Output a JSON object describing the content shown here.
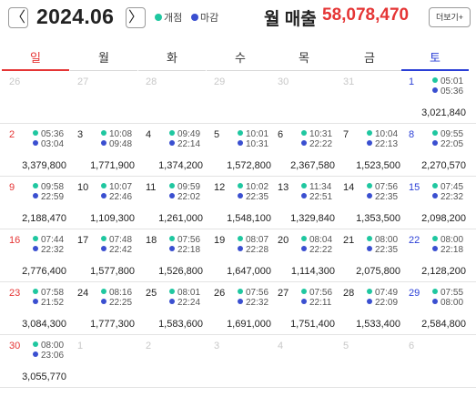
{
  "header": {
    "prev_label": "〈",
    "next_label": "〉",
    "month": "2024.06",
    "legend_open": "개점",
    "legend_close": "마감",
    "sales_label": "월 매출",
    "sales_value": "58,078,470",
    "more_label": "더보기+"
  },
  "colors": {
    "open_dot": "#1fc7a0",
    "close_dot": "#3a4fd0",
    "sunday": "#e53535",
    "saturday": "#2a3fd6",
    "sales": "#e53535"
  },
  "weekdays": [
    "일",
    "월",
    "화",
    "수",
    "목",
    "금",
    "토"
  ],
  "weeks": [
    [
      {
        "day": "26",
        "out": true
      },
      {
        "day": "27",
        "out": true
      },
      {
        "day": "28",
        "out": true
      },
      {
        "day": "29",
        "out": true
      },
      {
        "day": "30",
        "out": true
      },
      {
        "day": "31",
        "out": true
      },
      {
        "day": "1",
        "open": "05:01",
        "close": "05:36",
        "total": "3,021,840"
      }
    ],
    [
      {
        "day": "2",
        "open": "05:36",
        "close": "03:04",
        "total": "3,379,800"
      },
      {
        "day": "3",
        "open": "10:08",
        "close": "09:48",
        "total": "1,771,900"
      },
      {
        "day": "4",
        "open": "09:49",
        "close": "22:14",
        "total": "1,374,200"
      },
      {
        "day": "5",
        "open": "10:01",
        "close": "10:31",
        "total": "1,572,800"
      },
      {
        "day": "6",
        "open": "10:31",
        "close": "22:22",
        "total": "2,367,580"
      },
      {
        "day": "7",
        "open": "10:04",
        "close": "22:13",
        "total": "1,523,500"
      },
      {
        "day": "8",
        "open": "09:55",
        "close": "22:05",
        "total": "2,270,570"
      }
    ],
    [
      {
        "day": "9",
        "open": "09:58",
        "close": "22:59",
        "total": "2,188,470"
      },
      {
        "day": "10",
        "open": "10:07",
        "close": "22:46",
        "total": "1,109,300"
      },
      {
        "day": "11",
        "open": "09:59",
        "close": "22:02",
        "total": "1,261,000"
      },
      {
        "day": "12",
        "open": "10:02",
        "close": "22:35",
        "total": "1,548,100"
      },
      {
        "day": "13",
        "open": "11:34",
        "close": "22:51",
        "total": "1,329,840"
      },
      {
        "day": "14",
        "open": "07:56",
        "close": "22:35",
        "total": "1,353,500"
      },
      {
        "day": "15",
        "open": "07:45",
        "close": "22:32",
        "total": "2,098,200"
      }
    ],
    [
      {
        "day": "16",
        "open": "07:44",
        "close": "22:32",
        "total": "2,776,400"
      },
      {
        "day": "17",
        "open": "07:48",
        "close": "22:42",
        "total": "1,577,800"
      },
      {
        "day": "18",
        "open": "07:56",
        "close": "22:18",
        "total": "1,526,800"
      },
      {
        "day": "19",
        "open": "08:07",
        "close": "22:28",
        "total": "1,647,000"
      },
      {
        "day": "20",
        "open": "08:04",
        "close": "22:22",
        "total": "1,114,300"
      },
      {
        "day": "21",
        "open": "08:00",
        "close": "22:35",
        "total": "2,075,800"
      },
      {
        "day": "22",
        "open": "08:00",
        "close": "22:18",
        "total": "2,128,200"
      }
    ],
    [
      {
        "day": "23",
        "open": "07:58",
        "close": "21:52",
        "total": "3,084,300"
      },
      {
        "day": "24",
        "open": "08:16",
        "close": "22:25",
        "total": "1,777,300"
      },
      {
        "day": "25",
        "open": "08:01",
        "close": "22:24",
        "total": "1,583,600"
      },
      {
        "day": "26",
        "open": "07:56",
        "close": "22:32",
        "total": "1,691,000"
      },
      {
        "day": "27",
        "open": "07:56",
        "close": "22:11",
        "total": "1,751,400"
      },
      {
        "day": "28",
        "open": "07:49",
        "close": "22:09",
        "total": "1,533,400"
      },
      {
        "day": "29",
        "open": "07:55",
        "close": "08:00",
        "total": "2,584,800"
      }
    ],
    [
      {
        "day": "30",
        "open": "08:00",
        "close": "23:06",
        "total": "3,055,770"
      },
      {
        "day": "1",
        "out": true
      },
      {
        "day": "2",
        "out": true
      },
      {
        "day": "3",
        "out": true
      },
      {
        "day": "4",
        "out": true
      },
      {
        "day": "5",
        "out": true
      },
      {
        "day": "6",
        "out": true
      }
    ]
  ]
}
